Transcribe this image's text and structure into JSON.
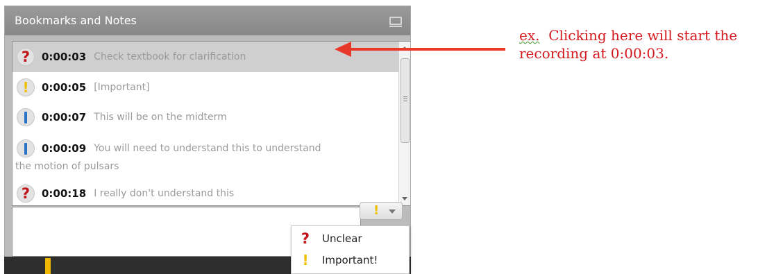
{
  "panel": {
    "title": "Bookmarks and Notes"
  },
  "bookmarks": [
    {
      "type": "unclear",
      "icon": "question-mark-icon",
      "time": "0:00:03",
      "text": "Check textbook for clarification",
      "selected": true
    },
    {
      "type": "important",
      "icon": "exclamation-icon",
      "time": "0:00:05",
      "text": "[Important]"
    },
    {
      "type": "note",
      "icon": "bookmark-bar-icon",
      "time": "0:00:07",
      "text": "This will be on the midterm"
    },
    {
      "type": "note",
      "icon": "bookmark-bar-icon",
      "time": "0:00:09",
      "text": "You will need to understand this to understand",
      "text_continued": "the motion of pulsars"
    },
    {
      "type": "unclear",
      "icon": "question-mark-icon",
      "time": "0:00:18",
      "text": "I really don't understand this"
    }
  ],
  "note_input": {
    "value": ""
  },
  "type_selector": {
    "icon": "exclamation-icon",
    "symbol": "!"
  },
  "dropdown": {
    "items": [
      {
        "icon": "question-mark-icon",
        "symbol": "?",
        "label": "Unclear"
      },
      {
        "icon": "exclamation-icon",
        "symbol": "!",
        "label": "Important!"
      }
    ]
  },
  "annotation": {
    "prefix": "ex.",
    "line1_rest": "  Clicking here will start the",
    "line2": "recording at 0:00:03."
  },
  "icon_symbols": {
    "unclear": "?",
    "important": "!"
  },
  "colors": {
    "unclear": "#c0141a",
    "important": "#f0c000",
    "note": "#2b74c4",
    "annotation": "#d3171c",
    "timeline_marker": "#f2b800"
  }
}
